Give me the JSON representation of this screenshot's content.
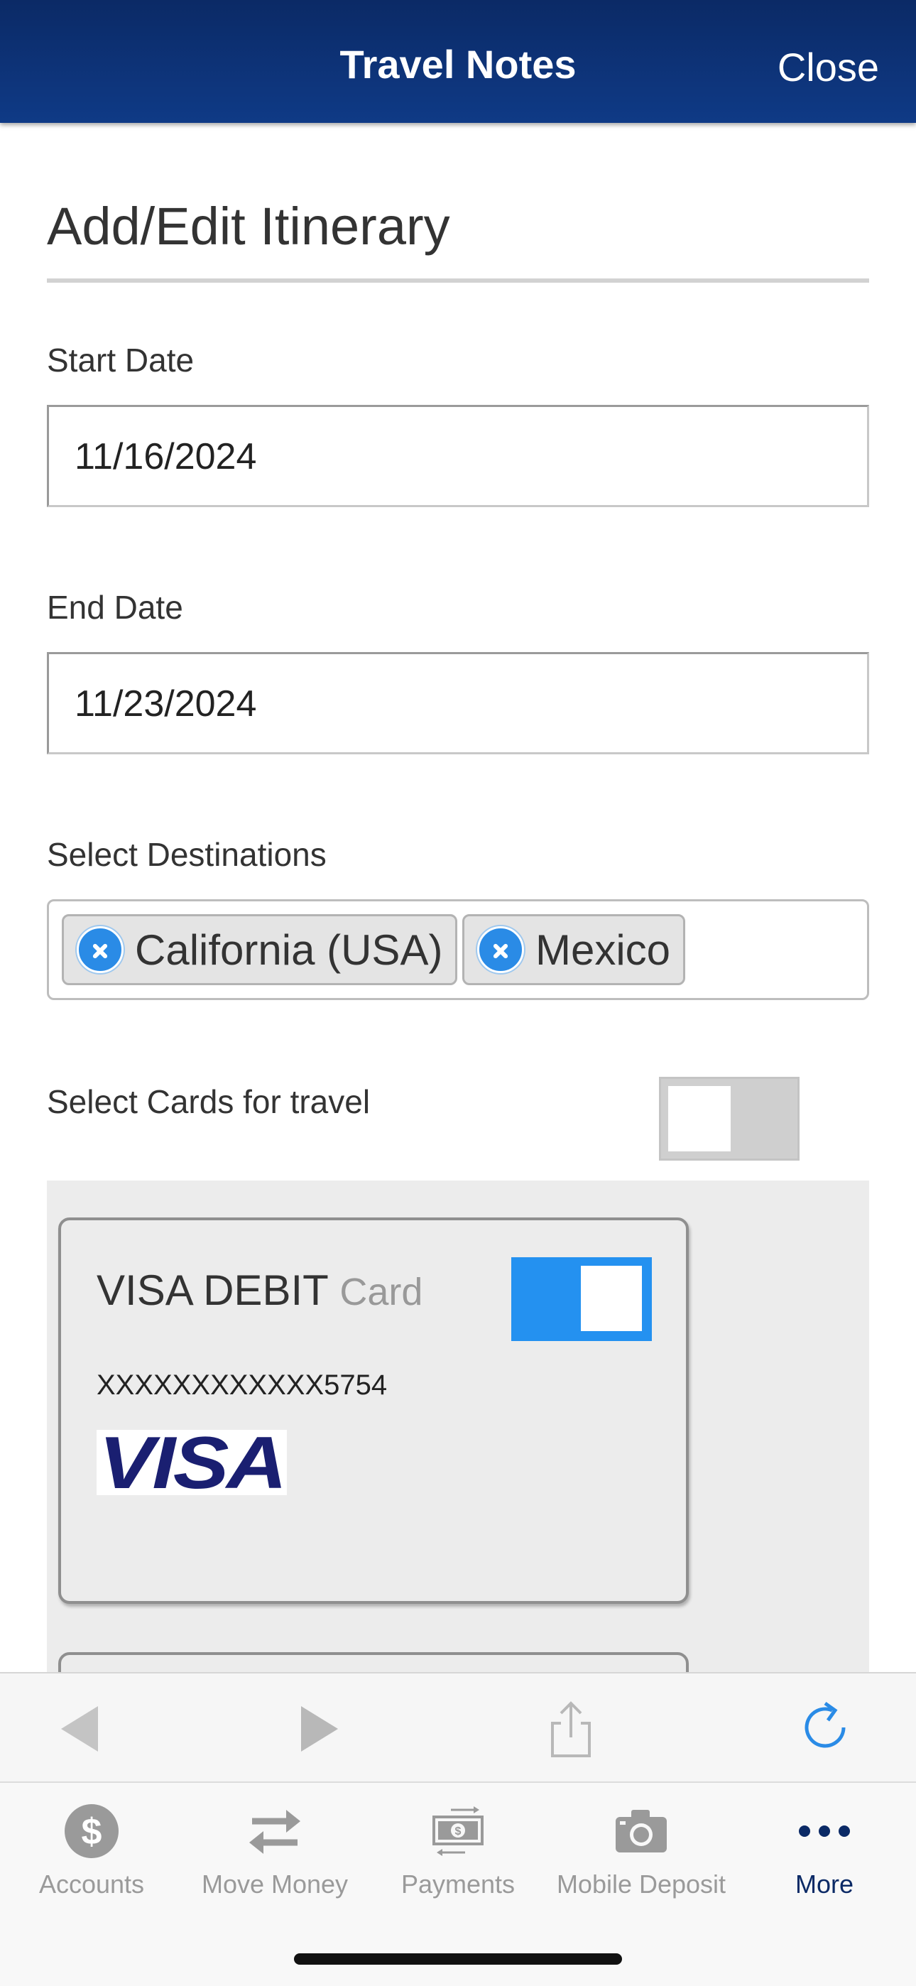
{
  "header": {
    "title": "Travel Notes",
    "close_label": "Close"
  },
  "form": {
    "title": "Add/Edit Itinerary",
    "start_date": {
      "label": "Start Date",
      "value": "11/16/2024"
    },
    "end_date": {
      "label": "End Date",
      "value": "11/23/2024"
    },
    "destinations": {
      "label": "Select Destinations",
      "selected": [
        "California (USA)",
        "Mexico"
      ]
    },
    "cards": {
      "label": "Select Cards for travel",
      "select_all_on": false,
      "items": [
        {
          "name": "VISA DEBIT",
          "type": "Card",
          "number": "XXXXXXXXXXXX5754",
          "brand": "VISA",
          "enabled": true
        }
      ]
    }
  },
  "browser_toolbar": {
    "icons": [
      "back-icon",
      "forward-icon",
      "share-icon",
      "refresh-icon"
    ]
  },
  "tabs": [
    {
      "label": "Accounts",
      "icon": "dollar-icon",
      "active": false
    },
    {
      "label": "Move Money",
      "icon": "transfer-icon",
      "active": false
    },
    {
      "label": "Payments",
      "icon": "payments-icon",
      "active": false
    },
    {
      "label": "Mobile Deposit",
      "icon": "camera-icon",
      "active": false
    },
    {
      "label": "More",
      "icon": "more-icon",
      "active": true
    }
  ],
  "colors": {
    "header": "#0f3a86",
    "accent": "#2491f0",
    "active_tab": "#0b2a66",
    "visa_blue": "#1a1f71"
  }
}
